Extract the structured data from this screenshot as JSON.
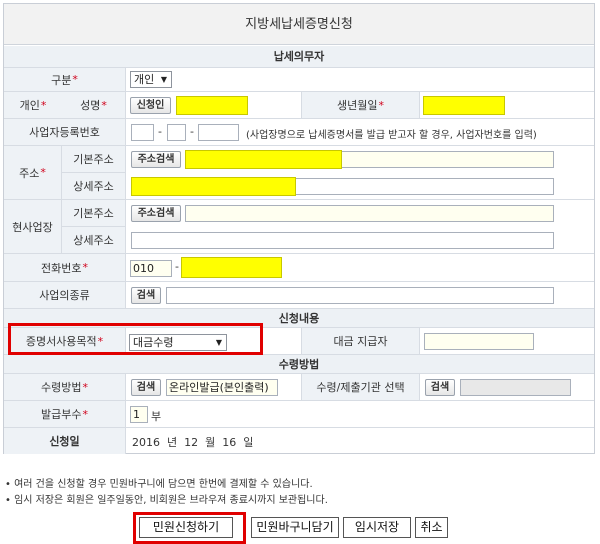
{
  "title": "지방세납세증명신청",
  "sections": {
    "taxpayer": "납세의무자",
    "application": "신청내용",
    "receipt": "수령방법"
  },
  "rows": {
    "gubun": {
      "label": "구분",
      "value": "개인"
    },
    "person": {
      "label": "개인",
      "name_label": "성명",
      "name_btn": "신청인",
      "birth_label": "생년월일"
    },
    "bizno": {
      "label": "사업자등록번호",
      "note": "(사업장명으로 납세증명서를 발급 받고자 할 경우, 사업자번호를 입력)"
    },
    "addr": {
      "label": "주소",
      "basic": "기본주소",
      "detail": "상세주소",
      "search_btn": "주소검색"
    },
    "work": {
      "label": "현사업장",
      "basic": "기본주소",
      "detail": "상세주소",
      "search_btn": "주소검색"
    },
    "phone": {
      "label": "전화번호",
      "area": "010"
    },
    "biztype": {
      "label": "사업의종류",
      "btn": "검색"
    },
    "purpose": {
      "label": "증명서사용목적",
      "value": "대금수령",
      "payer_label": "대금 지급자"
    },
    "method": {
      "label": "수령방법",
      "btn": "검색",
      "value": "온라인발급(본인출력)",
      "agency_label": "수령/제출기관 선택",
      "agency_btn": "검색"
    },
    "copies": {
      "label": "발급부수",
      "value": "1",
      "unit": "부"
    },
    "date": {
      "label": "신청일",
      "year": "2016",
      "y": "년",
      "month": "12",
      "m": "월",
      "day": "16",
      "d": "일"
    }
  },
  "notes": [
    "• 여러 건을 신청할 경우 민원바구니에 담으면 한번에 결제할 수 있습니다.",
    "• 임시 저장은 회원은 일주일동안, 비회원은 브라우져 종료시까지 보관됩니다."
  ],
  "buttons": {
    "apply": "민원신청하기",
    "basket": "민원바구니담기",
    "temp_save": "임시저장",
    "cancel": "취소"
  },
  "colors": {
    "highlight": "#ffff00",
    "red_box": "#e00000",
    "required": "#d0021b"
  }
}
